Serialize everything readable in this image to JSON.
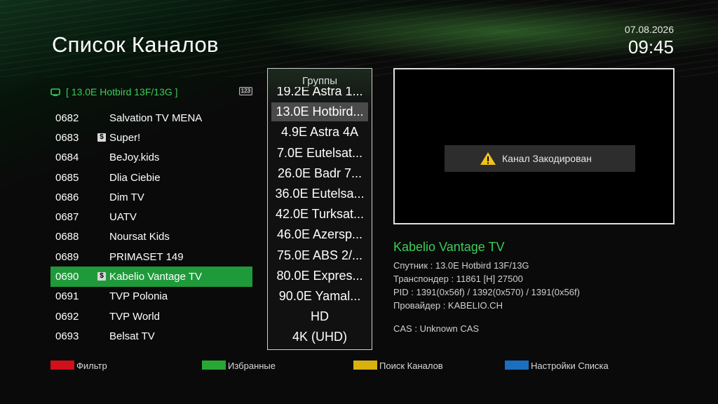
{
  "header": {
    "title": "Список Каналов",
    "date": "07.08.2026",
    "time": "09:45"
  },
  "satellite": {
    "label": "[ 13.0E Hotbird 13F/13G ]",
    "badge": "123",
    "icon": "tv-icon"
  },
  "channels": [
    {
      "num": "0682",
      "name": "Salvation TV MENA",
      "scrambled": false
    },
    {
      "num": "0683",
      "name": "Super!",
      "scrambled": true
    },
    {
      "num": "0684",
      "name": "BeJoy.kids",
      "scrambled": false
    },
    {
      "num": "0685",
      "name": "Dlia Ciebie",
      "scrambled": false
    },
    {
      "num": "0686",
      "name": "Dim TV",
      "scrambled": false
    },
    {
      "num": "0687",
      "name": "UATV",
      "scrambled": false
    },
    {
      "num": "0688",
      "name": "Noursat Kids",
      "scrambled": false
    },
    {
      "num": "0689",
      "name": "PRIMASET 149",
      "scrambled": false
    },
    {
      "num": "0690",
      "name": "Kabelio Vantage TV",
      "scrambled": true,
      "selected": true
    },
    {
      "num": "0691",
      "name": "TVP Polonia",
      "scrambled": false
    },
    {
      "num": "0692",
      "name": "TVP World",
      "scrambled": false
    },
    {
      "num": "0693",
      "name": "Belsat TV",
      "scrambled": false
    }
  ],
  "scrambled_marker": "$",
  "groups": {
    "title": "Группы",
    "items": [
      {
        "label": "19.2E Astra 1..."
      },
      {
        "label": "13.0E Hotbird...",
        "selected": true
      },
      {
        "label": "4.9E Astra 4A"
      },
      {
        "label": "7.0E Eutelsat..."
      },
      {
        "label": "26.0E Badr  7..."
      },
      {
        "label": "36.0E Eutelsa..."
      },
      {
        "label": "42.0E Turksat..."
      },
      {
        "label": "46.0E Azersp..."
      },
      {
        "label": "75.0E ABS 2/..."
      },
      {
        "label": "80.0E Expres..."
      },
      {
        "label": "90.0E Yamal..."
      },
      {
        "label": "HD"
      },
      {
        "label": "4K (UHD)"
      }
    ]
  },
  "preview": {
    "message": "Канал Закодирован",
    "icon": "warning-icon"
  },
  "info": {
    "channel_name": "Kabelio Vantage TV",
    "lines": [
      "Спутник : 13.0E Hotbird 13F/13G",
      "Транспондер : 11861 [H] 27500",
      "PID : 1391(0x56f) / 1392(0x570) / 1391(0x56f)",
      "Провайдер : KABELIO.CH",
      "CAS : Unknown CAS"
    ]
  },
  "footer": [
    {
      "color": "#d0101a",
      "label": "Фильтр"
    },
    {
      "color": "#27a833",
      "label": "Избранные"
    },
    {
      "color": "#d8b10e",
      "label": "Поиск Каналов"
    },
    {
      "color": "#1a6fc0",
      "label": "Настройки Списка"
    }
  ],
  "colors": {
    "accent": "#3ccc59",
    "selection": "#1f9a3a"
  }
}
